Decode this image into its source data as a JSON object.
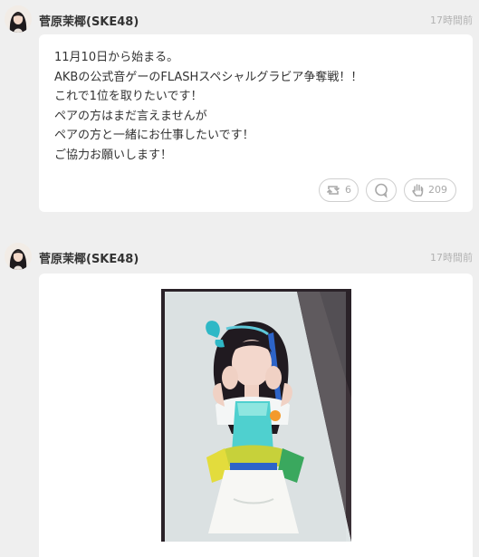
{
  "posts": [
    {
      "author": "菅原茉椰(SKE48)",
      "timestamp": "17時間前",
      "lines": [
        "11月10日から始まる。",
        "AKBの公式音ゲーのFLASHスペシャルグラビア争奪戦！！",
        "これで1位を取りたいです！",
        "ペアの方はまだ言えませんが",
        "ペアの方と一緒にお仕事したいです！",
        "ご協力お願いします！"
      ],
      "actions": {
        "retweet": {
          "icon": "retweet-icon",
          "count": "6"
        },
        "comment": {
          "icon": "comment-icon"
        },
        "like": {
          "icon": "hand-icon",
          "count": "209"
        }
      }
    },
    {
      "author": "菅原茉椰(SKE48)",
      "timestamp": "17時間前",
      "image": "photo of idol in stage costume with blue ribbon",
      "image_icon": "photo-image"
    }
  ],
  "colors": {
    "background": "#efefef",
    "card": "#ffffff",
    "author": "#333333",
    "timestamp": "#b2b2b2",
    "action": "#a9a9a9"
  }
}
